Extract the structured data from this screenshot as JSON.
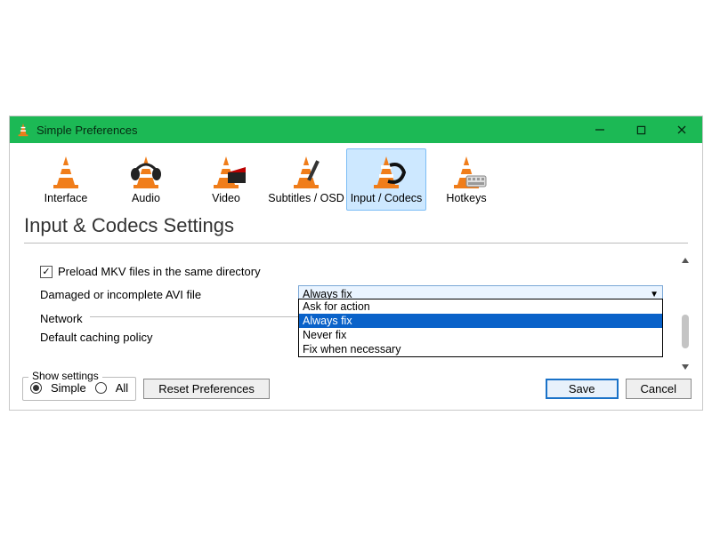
{
  "titlebar": {
    "title": "Simple Preferences"
  },
  "categories": [
    {
      "label": "Interface"
    },
    {
      "label": "Audio"
    },
    {
      "label": "Video"
    },
    {
      "label": "Subtitles / OSD"
    },
    {
      "label": "Input / Codecs"
    },
    {
      "label": "Hotkeys"
    }
  ],
  "section": {
    "heading": "Input & Codecs Settings"
  },
  "form": {
    "preload_label": "Preload MKV files in the same directory",
    "preload_checked": true,
    "avi_label": "Damaged or incomplete AVI file",
    "avi_selected": "Always fix",
    "avi_options": [
      "Ask for action",
      "Always fix",
      "Never fix",
      "Fix when necessary"
    ],
    "network_group": "Network",
    "caching_label": "Default caching policy"
  },
  "footer": {
    "show_settings_legend": "Show settings",
    "radio_simple": "Simple",
    "radio_all": "All",
    "reset_btn": "Reset Preferences",
    "save_btn": "Save",
    "cancel_btn": "Cancel"
  }
}
